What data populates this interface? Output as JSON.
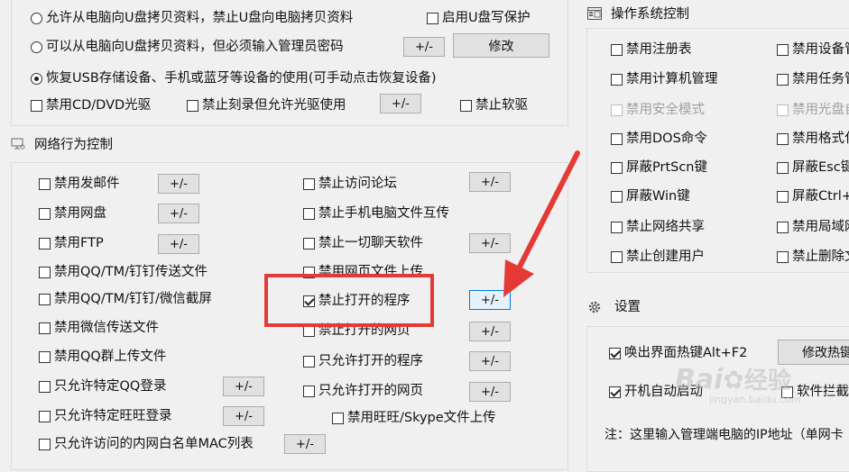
{
  "usb": {
    "radio1": "允许从电脑向U盘拷贝资料，禁止U盘向电脑拷贝资料",
    "radio2": "可以从电脑向U盘拷贝资料，但必须输入管理员密码",
    "radio3": "恢复USB存储设备、手机或蓝牙等设备的使用(可手动点击恢复设备)",
    "usb_write_protect": "启用U盘写保护",
    "modify": "修改",
    "cd_dvd": "禁用CD/DVD光驱",
    "burn": "禁止刻录但允许光驱使用",
    "floppy": "禁止软驱"
  },
  "network": {
    "title": "网络行为控制",
    "left": [
      "禁用发邮件",
      "禁用网盘",
      "禁用FTP",
      "禁用QQ/TM/钉钉传送文件",
      "禁用QQ/TM/钉钉/微信截屏",
      "禁用微信传送文件",
      "禁用QQ群上传文件",
      "只允许特定QQ登录",
      "只允许特定旺旺登录",
      "只允许访问的内网白名单MAC列表"
    ],
    "right": [
      "禁止访问论坛",
      "禁止手机电脑文件互传",
      "禁止一切聊天软件",
      "禁用网页文件上传",
      "禁止打开的程序",
      "禁止打开的网页",
      "只允许打开的程序",
      "只允许打开的网页",
      "禁用旺旺/Skype文件上传"
    ]
  },
  "os": {
    "title": "操作系统控制",
    "col1": [
      "禁用注册表",
      "禁用计算机管理",
      "禁用安全模式",
      "禁用DOS命令",
      "屏蔽PrtScn键",
      "屏蔽Win键",
      "禁止网络共享",
      "禁止创建用户"
    ],
    "col2": [
      "禁用设备管",
      "禁用任务管",
      "禁用光盘自",
      "禁用格式化",
      "屏蔽Esc键",
      "屏蔽Ctrl+",
      "禁用局域网",
      "禁止删除文"
    ]
  },
  "settings": {
    "title": "设置",
    "hotkey": "唤出界面热键Alt+F2",
    "modify_hotkey": "修改热键",
    "autostart": "开机自动启动",
    "intercept": "软件拦截",
    "note": "注：这里输入管理端电脑的IP地址（单网卡"
  },
  "pm_label": "+/-",
  "watermark": {
    "brand": "Bai",
    "suffix": "经验",
    "domain": "jingyan.baidu.com"
  },
  "colors": {
    "highlight": "#e53935",
    "focus": "#0078d7"
  }
}
